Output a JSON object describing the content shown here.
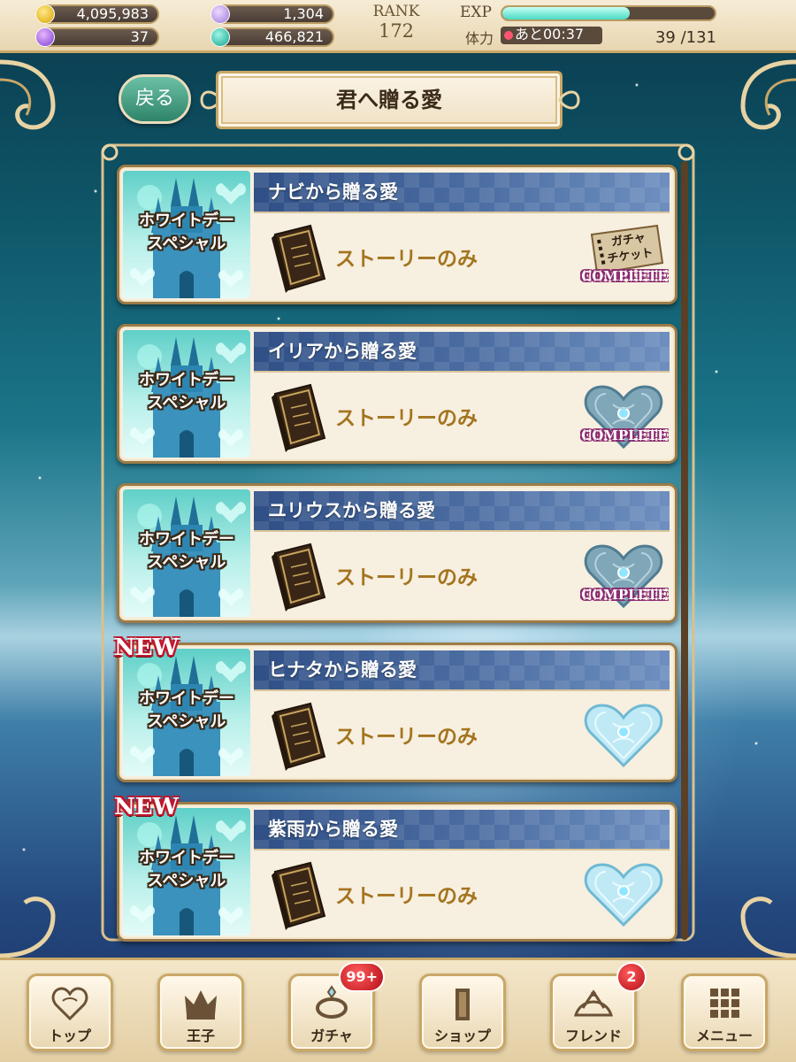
{
  "status": {
    "coins": "4,095,983",
    "gems": "37",
    "tickets": "1,304",
    "points": "466,821",
    "rank_label": "RANK",
    "rank_value": "172",
    "exp_label": "EXP",
    "exp_fraction": 0.6,
    "stamina_label": "体力",
    "stamina_recover": "あと00:37",
    "stamina_value": "39 /131"
  },
  "header": {
    "back_label": "戻る",
    "title": "君へ贈る愛"
  },
  "event_items": [
    {
      "thumb_text": "ホワイトデー\nスペシャル",
      "title": "ナビから贈る愛",
      "story": "ストーリーのみ",
      "is_new": false,
      "new_label": "",
      "reward": "ticket",
      "reward_lines": [
        "ガチャ",
        "チケット"
      ],
      "complete": "COMPLETE"
    },
    {
      "thumb_text": "ホワイトデー\nスペシャル",
      "title": "イリアから贈る愛",
      "story": "ストーリーのみ",
      "is_new": false,
      "new_label": "",
      "reward": "heart",
      "reward_lines": [],
      "complete": "COMPLETE"
    },
    {
      "thumb_text": "ホワイトデー\nスペシャル",
      "title": "ユリウスから贈る愛",
      "story": "ストーリーのみ",
      "is_new": false,
      "new_label": "",
      "reward": "heart",
      "reward_lines": [],
      "complete": "COMPLETE"
    },
    {
      "thumb_text": "ホワイトデー\nスペシャル",
      "title": "ヒナタから贈る愛",
      "story": "ストーリーのみ",
      "is_new": true,
      "new_label": "NEW",
      "reward": "heart-light",
      "reward_lines": [],
      "complete": ""
    },
    {
      "thumb_text": "ホワイトデー\nスペシャル",
      "title": "紫雨から贈る愛",
      "story": "ストーリーのみ",
      "is_new": true,
      "new_label": "NEW",
      "reward": "heart-light",
      "reward_lines": [],
      "complete": ""
    }
  ],
  "nav": [
    {
      "label": "トップ",
      "icon": "heart-icon",
      "badge": ""
    },
    {
      "label": "王子",
      "icon": "crown-icon",
      "badge": ""
    },
    {
      "label": "ガチャ",
      "icon": "ring-icon",
      "badge": "99+"
    },
    {
      "label": "ショップ",
      "icon": "shop-icon",
      "badge": ""
    },
    {
      "label": "フレンド",
      "icon": "tiara-icon",
      "badge": "2"
    },
    {
      "label": "メニュー",
      "icon": "grid-menu-icon",
      "badge": ""
    }
  ]
}
